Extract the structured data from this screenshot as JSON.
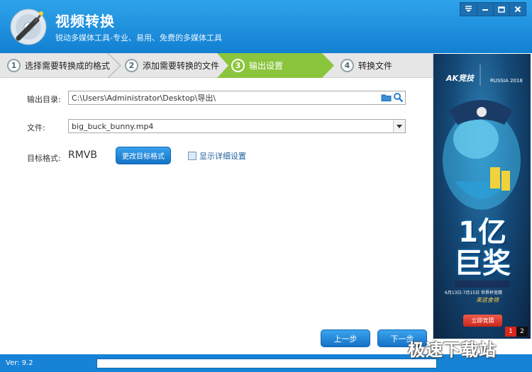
{
  "window": {
    "title": "视频转换",
    "subtitle": "锐动多媒体工具-专业、易用、免费的多媒体工具",
    "controls": [
      "menu-icon",
      "minimize-icon",
      "maximize-icon",
      "close-icon"
    ]
  },
  "steps": [
    {
      "num": "1",
      "label": "选择需要转换成的格式",
      "active": false
    },
    {
      "num": "2",
      "label": "添加需要转换的文件",
      "active": false
    },
    {
      "num": "3",
      "label": "输出设置",
      "active": true
    },
    {
      "num": "4",
      "label": "转换文件",
      "active": false
    }
  ],
  "form": {
    "output_dir_label": "输出目录:",
    "output_dir_value": "C:\\Users\\Administrator\\Desktop\\导出\\",
    "file_label": "文件:",
    "file_value": "big_buck_bunny.mp4",
    "format_label": "目标格式:",
    "format_value": "RMVB",
    "change_format_label": "更改目标格式",
    "show_details_label": "显示详细设置"
  },
  "nav": {
    "prev_label": "上一步",
    "next_label": "下一步"
  },
  "ad": {
    "logo": "AK竞技",
    "event": "RUSSIA 2018",
    "headline": "1亿\n巨奖",
    "date": "6月13日-7月15日 世界杯竞猜",
    "slogan": "来这舍领",
    "button": "立即竞猜",
    "pages": [
      "1",
      "2"
    ],
    "current_page": "1"
  },
  "status": {
    "version": "Ver: 9.2",
    "progress": 0
  },
  "watermark": "极速下载站",
  "colors": {
    "header": "#1c8fe0",
    "step_active": "#8ac53d",
    "button": "#1f86dc",
    "status_bar": "#1683d6"
  }
}
